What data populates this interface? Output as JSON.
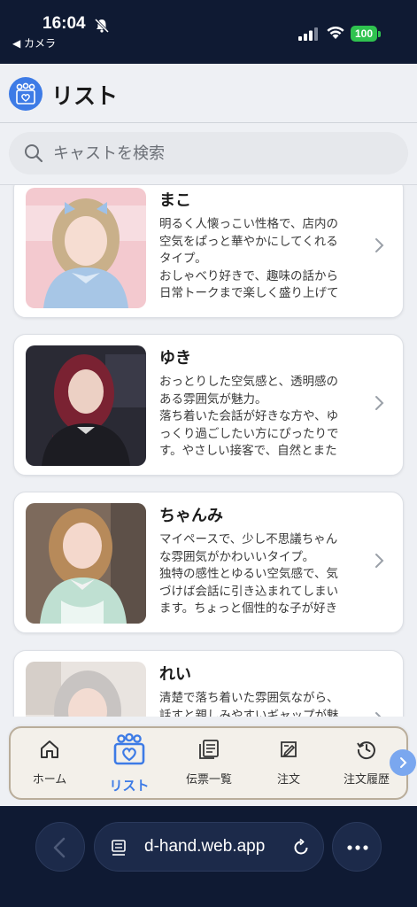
{
  "status_bar": {
    "time": "16:04",
    "back_app": "◀ カメラ",
    "battery": "100"
  },
  "header": {
    "title": "リスト",
    "logo_icon": "heart-people-icon"
  },
  "search": {
    "placeholder": "キャストを検索",
    "value": ""
  },
  "casts": [
    {
      "name": "まこ",
      "description": "明るく人懐っこい性格で、店内の\n空気をぱっと華やかにしてくれる\nタイプ。\nおしゃべり好きで、趣味の話から\n日常トークまで楽しく盛り上げて",
      "photo_colors": [
        "#f3c9cf",
        "#c9b08a",
        "#a7c6e6"
      ]
    },
    {
      "name": "ゆき",
      "description": "おっとりした空気感と、透明感の\nある雰囲気が魅力。\n落ち着いた会話が好きな方や、ゆ\nっくり過ごしたい方にぴったりで\nす。やさしい接客で、自然とまた",
      "photo_colors": [
        "#2a2a34",
        "#7a2232",
        "#1c1c22"
      ]
    },
    {
      "name": "ちゃんみ",
      "description": "マイペースで、少し不思議ちゃん\nな雰囲気がかわいいタイプ。\n独特の感性とゆるい空気感で、気\nづけば会話に引き込まれてしまい\nます。ちょっと個性的な子が好き",
      "photo_colors": [
        "#7d6a5c",
        "#b78a5a",
        "#bfe0d2"
      ]
    },
    {
      "name": "れい",
      "description": "清楚で落ち着いた雰囲気ながら、\n話すと親しみやすいギャップが魅",
      "photo_colors": [
        "#c8c4c2",
        "#a39a93",
        "#e9e4e0"
      ]
    }
  ],
  "nav": [
    {
      "label": "ホーム",
      "icon": "home-icon",
      "active": false
    },
    {
      "label": "リスト",
      "icon": "heart-people-icon",
      "active": true
    },
    {
      "label": "伝票一覧",
      "icon": "document-list-icon",
      "active": false
    },
    {
      "label": "注文",
      "icon": "order-icon",
      "active": false
    },
    {
      "label": "注文履歴",
      "icon": "history-icon",
      "active": false
    }
  ],
  "browser": {
    "url": "d-hand.web.app"
  },
  "colors": {
    "accent": "#3d7be6",
    "nav_border": "#b9ad9a"
  }
}
